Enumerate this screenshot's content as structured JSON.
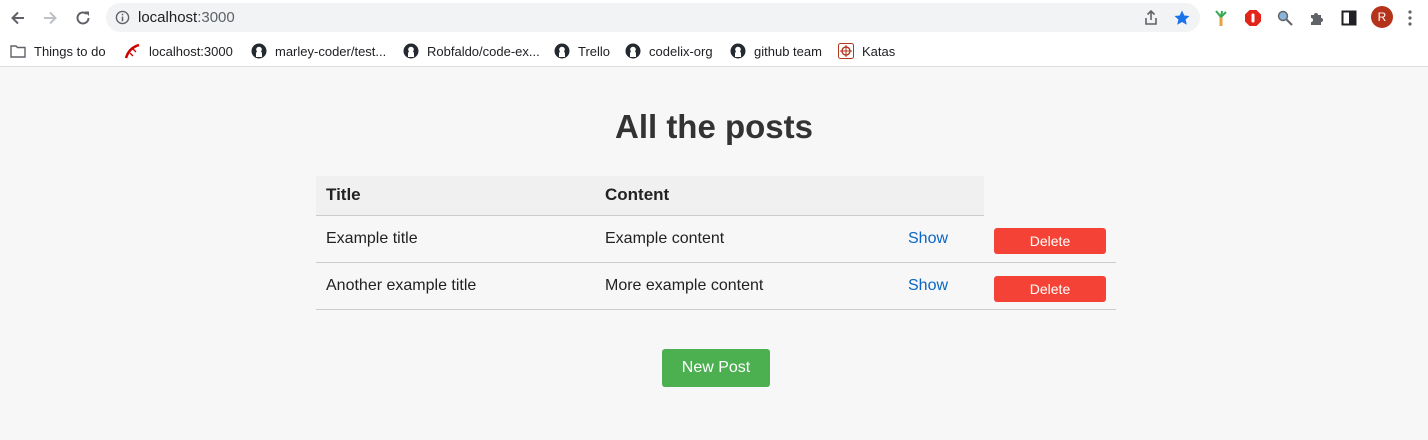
{
  "browser": {
    "url_host": "localhost",
    "url_port": ":3000",
    "profile_initial": "R",
    "bookmarks": [
      {
        "label": "Things to do",
        "icon": "folder-icon"
      },
      {
        "label": "localhost:3000",
        "icon": "rails-icon"
      },
      {
        "label": "marley-coder/test...",
        "icon": "github-icon"
      },
      {
        "label": "Robfaldo/code-ex...",
        "icon": "github-icon"
      },
      {
        "label": "Trello",
        "icon": "github-icon"
      },
      {
        "label": "codelix-org",
        "icon": "github-icon"
      },
      {
        "label": "github team",
        "icon": "github-icon"
      },
      {
        "label": "Katas",
        "icon": "codewars-icon"
      }
    ],
    "colors": {
      "star": "#1a73e8",
      "avatar": "#b5331b"
    }
  },
  "page": {
    "title": "All the posts",
    "columns": {
      "title": "Title",
      "content": "Content"
    },
    "posts": [
      {
        "title": "Example title",
        "content": "Example content",
        "show": "Show",
        "delete": "Delete"
      },
      {
        "title": "Another example title",
        "content": "More example content",
        "show": "Show",
        "delete": "Delete"
      }
    ],
    "new_post_label": "New Post",
    "colors": {
      "delete": "#f44336",
      "new_post": "#4caf50",
      "link": "#0a66c2"
    }
  }
}
